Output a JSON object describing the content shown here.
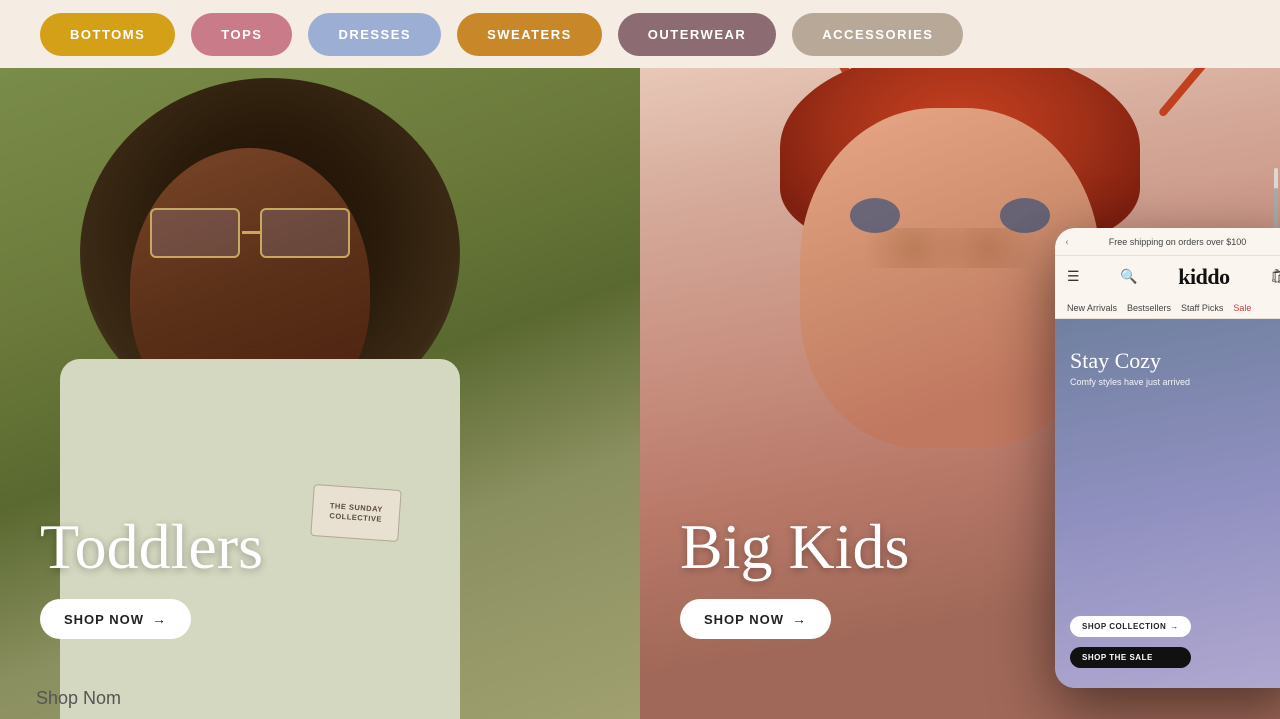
{
  "categories": [
    {
      "id": "bottoms",
      "label": "BOTTOMS",
      "color": "#d4a017",
      "class": "bottoms"
    },
    {
      "id": "tops",
      "label": "TOPS",
      "color": "#c97b8a",
      "class": "tops"
    },
    {
      "id": "dresses",
      "label": "DRESSES",
      "color": "#9daed4",
      "class": "dresses"
    },
    {
      "id": "sweaters",
      "label": "SWEATERS",
      "color": "#c8882a",
      "class": "sweaters"
    },
    {
      "id": "outerwear",
      "label": "OUTERWEAR",
      "color": "#8c6b72",
      "class": "outerwear"
    },
    {
      "id": "accessories",
      "label": "ACCESSORIES",
      "color": "#b8a898",
      "class": "accessories"
    }
  ],
  "hero_left": {
    "title": "Toddlers",
    "shop_btn": "SHOP NOW",
    "shirt_tag_line1": "THE SUNDAY",
    "shirt_tag_line2": "COLLECTIVE"
  },
  "hero_right": {
    "title": "Big Kids",
    "shop_btn": "SHOP NOW"
  },
  "phone": {
    "banner_text": "Free shipping on orders over $100",
    "logo": "kiddo",
    "nav_items": [
      "New Arrivals",
      "Bestsellers",
      "Staff Picks",
      "Sale"
    ],
    "hero_title": "Stay Cozy",
    "hero_subtitle": "Comfy styles have just arrived",
    "btn_collection": "SHOP COLLECTION",
    "btn_sale": "SHOP THE SALE"
  },
  "shop_nom": {
    "text": "Shop Nom"
  }
}
